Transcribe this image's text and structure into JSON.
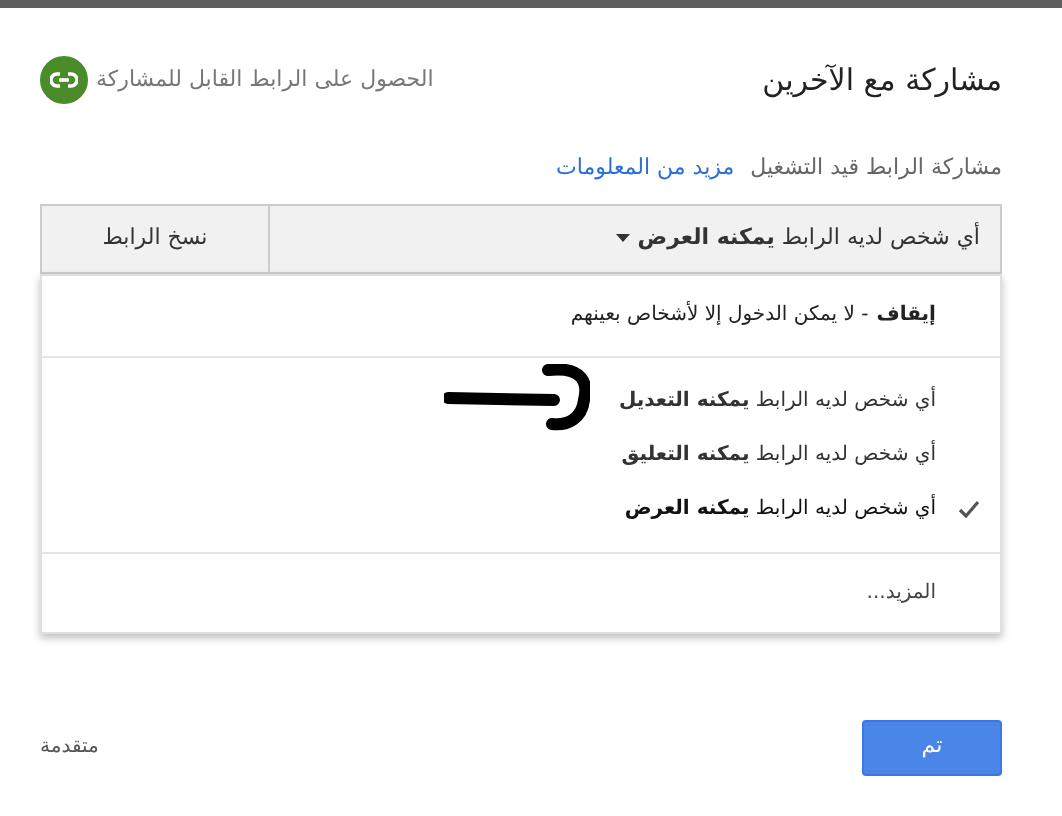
{
  "dialog": {
    "title": "مشاركة مع الآخرين",
    "get_link": "الحصول على الرابط القابل للمشاركة"
  },
  "link_status": {
    "text": "مشاركة الرابط قيد التشغيل",
    "learn_more": "مزيد من المعلومات"
  },
  "access_dropdown": {
    "value": "أي شخص لديه الرابط **يمكنه العرض**",
    "copy_button": "نسخ الرابط"
  },
  "menu": {
    "stop": "**إيقاف** - لا يمكن الدخول إلا لأشخاص بعينهم",
    "options": [
      {
        "label": "أي شخص لديه الرابط **يمكنه التعديل**",
        "selected": false
      },
      {
        "label": "أي شخص لديه الرابط **يمكنه التعليق**",
        "selected": false
      },
      {
        "label": "أي شخص لديه الرابط **يمكنه العرض**",
        "selected": true
      }
    ],
    "more": "المزيد..."
  },
  "footer": {
    "advanced": "متقدمة",
    "done_button": "تم"
  }
}
